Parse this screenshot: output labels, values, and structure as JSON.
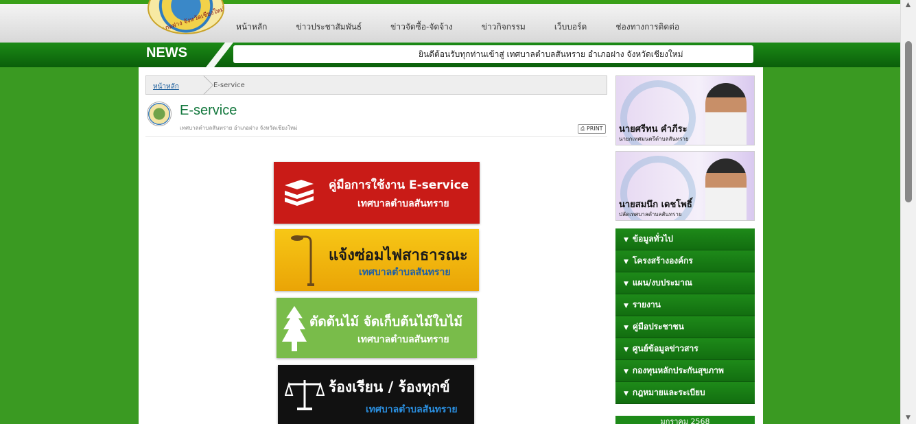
{
  "logo": {
    "text": "อำเภอฝาง จังหวัดเชียงใหม่"
  },
  "nav": [
    {
      "label": "หน้าหลัก",
      "name": "nav-home"
    },
    {
      "label": "ข่าวประชาสัมพันธ์",
      "name": "nav-pr-news"
    },
    {
      "label": "ข่าวจัดซื้อ-จัดจ้าง",
      "name": "nav-procurement"
    },
    {
      "label": "ข่าวกิจกรรม",
      "name": "nav-activities"
    },
    {
      "label": "เว็บบอร์ด",
      "name": "nav-webboard"
    },
    {
      "label": "ช่องทางการติดต่อ",
      "name": "nav-contact"
    }
  ],
  "news": {
    "label": "NEWS",
    "ticker": "ยินดีต้อนรับทุกท่านเข้าสู่ เทศบาลตำบลสันทราย อำเภอฝาง จังหวัดเชียงใหม่"
  },
  "breadcrumb": {
    "home": "หน้าหลัก",
    "current": "E-service"
  },
  "page": {
    "title": "E-service",
    "subtitle": "เทศบาลตำบลสันทราย อำเภอฝาง จังหวัดเชียงใหม่",
    "print_label": "PRINT"
  },
  "banners": [
    {
      "line1": "คู่มือการใช้งาน E-service",
      "line2": "เทศบาลตำบลสันทราย",
      "icon": "books-icon"
    },
    {
      "line1": "แจ้งซ่อมไฟสาธารณะ",
      "line2": "เทศบาลตำบลสันทราย",
      "icon": "streetlight-icon"
    },
    {
      "line1": "ตัดต้นไม้ จัดเก็บต้นไม้ใบไม้",
      "line2": "เทศบาลตำบลสันทราย",
      "icon": "tree-icon"
    },
    {
      "line1": "ร้องเรียน / ร้องทุกข์",
      "line2": "เทศบาลตำบลสันทราย",
      "icon": "scales-icon"
    }
  ],
  "officials": [
    {
      "name": "นายศรีทน คำภีระ",
      "title": "นายกเทศมนตรีตำบลสันทราย"
    },
    {
      "name": "นายสมนึก เดชโพธิ์",
      "title": "ปลัดเทศบาลตำบลสันทราย"
    }
  ],
  "menu": [
    "ข้อมูลทั่วไป",
    "โครงสร้างองค์กร",
    "แผน/งบประมาณ",
    "รายงาน",
    "คู่มือประชาชน",
    "ศูนย์ข้อมูลข่าวสาร",
    "กองทุนหลักประกันสุขภาพ",
    "กฎหมายและระเบียบ"
  ],
  "menu_partial": "มกราคม 2568",
  "colors": {
    "green": "#1e8a19",
    "red": "#c91b17",
    "yellow": "#f7c716",
    "light_green": "#79bc4a",
    "black": "#111111"
  }
}
